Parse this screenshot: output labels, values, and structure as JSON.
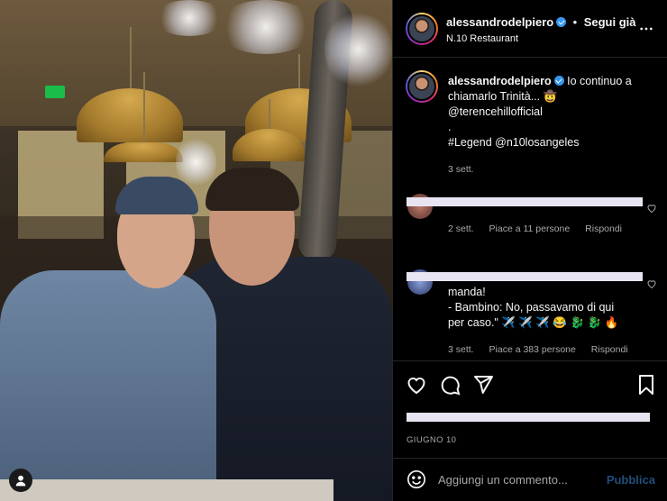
{
  "post": {
    "author": "alessandrodelpiero",
    "follow_label": "Segui già",
    "location": "N.10 Restaurant",
    "more_icon": "more-horizontal-icon"
  },
  "caption": {
    "author": "alessandrodelpiero",
    "line1": "Io continuo a",
    "line2": "chiamarlo Trinità... 🤠",
    "mention": "@terencehillofficial",
    "dot": ".",
    "tags": "#Legend @n10losangeles",
    "age": "3 sett."
  },
  "comments": [
    {
      "meta_age": "2 sett.",
      "meta_likes": "Piace a 11 persone",
      "reply": "Rispondi"
    },
    {
      "line1": "manda!",
      "line2": "- Bambino: No, passavamo di qui",
      "line3": "per caso.\" ✈️ ✈️ ✈️ 😂 🐉 🐉 🔥",
      "meta_age": "3 sett.",
      "meta_likes": "Piace a 383 persone",
      "reply": "Rispondi"
    }
  ],
  "actions": {
    "like_icon": "heart-icon",
    "comment_icon": "comment-icon",
    "share_icon": "share-icon",
    "save_icon": "bookmark-icon"
  },
  "date": "GIUGNO 10",
  "composer": {
    "placeholder": "Aggiungi un commento...",
    "publish_label": "Pubblica"
  },
  "colors": {
    "background": "#000000",
    "verified": "#3897f0",
    "publish_disabled": "#1f4f7a",
    "redaction": "#e8e4f2"
  }
}
